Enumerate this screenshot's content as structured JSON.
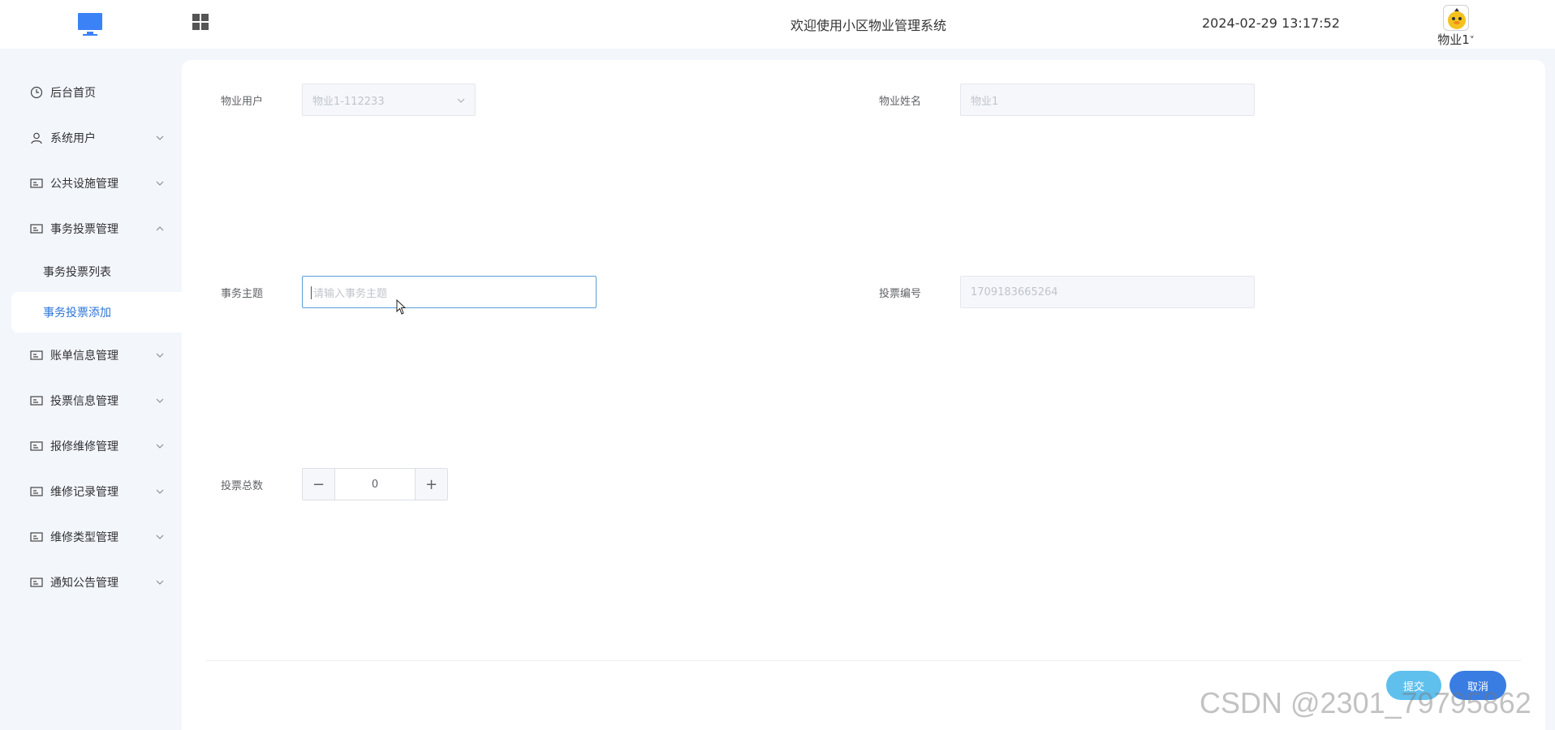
{
  "header": {
    "title": "欢迎使用小区物业管理系统",
    "datetime": "2024-02-29 13:17:52",
    "user_name": "物业1",
    "user_menu_glyph": "˅",
    "logo_icon": "monitor-icon",
    "apps_icon": "grid-icon"
  },
  "sidebar": {
    "items": [
      {
        "label": "后台首页",
        "icon": "clock-icon"
      },
      {
        "label": "系统用户",
        "icon": "user-icon"
      },
      {
        "label": "公共设施管理",
        "icon": "card-icon"
      },
      {
        "label": "事务投票管理",
        "icon": "card-icon"
      },
      {
        "label": "账单信息管理",
        "icon": "card-icon"
      },
      {
        "label": "投票信息管理",
        "icon": "card-icon"
      },
      {
        "label": "报修维修管理",
        "icon": "card-icon"
      },
      {
        "label": "维修记录管理",
        "icon": "card-icon"
      },
      {
        "label": "维修类型管理",
        "icon": "card-icon"
      },
      {
        "label": "通知公告管理",
        "icon": "card-icon"
      }
    ],
    "sub_items": [
      {
        "label": "事务投票列表"
      },
      {
        "label": "事务投票添加"
      }
    ]
  },
  "form": {
    "user_label": "物业用户",
    "user_value": "物业1-112233",
    "name_label": "物业姓名",
    "name_value": "物业1",
    "subject_label": "事务主题",
    "subject_placeholder": "请输入事务主题",
    "vote_no_label": "投票编号",
    "vote_no_value": "1709183665264",
    "total_label": "投票总数",
    "total_value": "0",
    "minus": "−",
    "plus": "+"
  },
  "actions": {
    "submit": "提交",
    "cancel": "取消"
  },
  "watermark": "CSDN @2301_79795862",
  "colors": {
    "accent": "#2d74d6",
    "submit": "#5fc0ee",
    "cancel": "#3a7de2",
    "background": "#f3f6fb"
  }
}
